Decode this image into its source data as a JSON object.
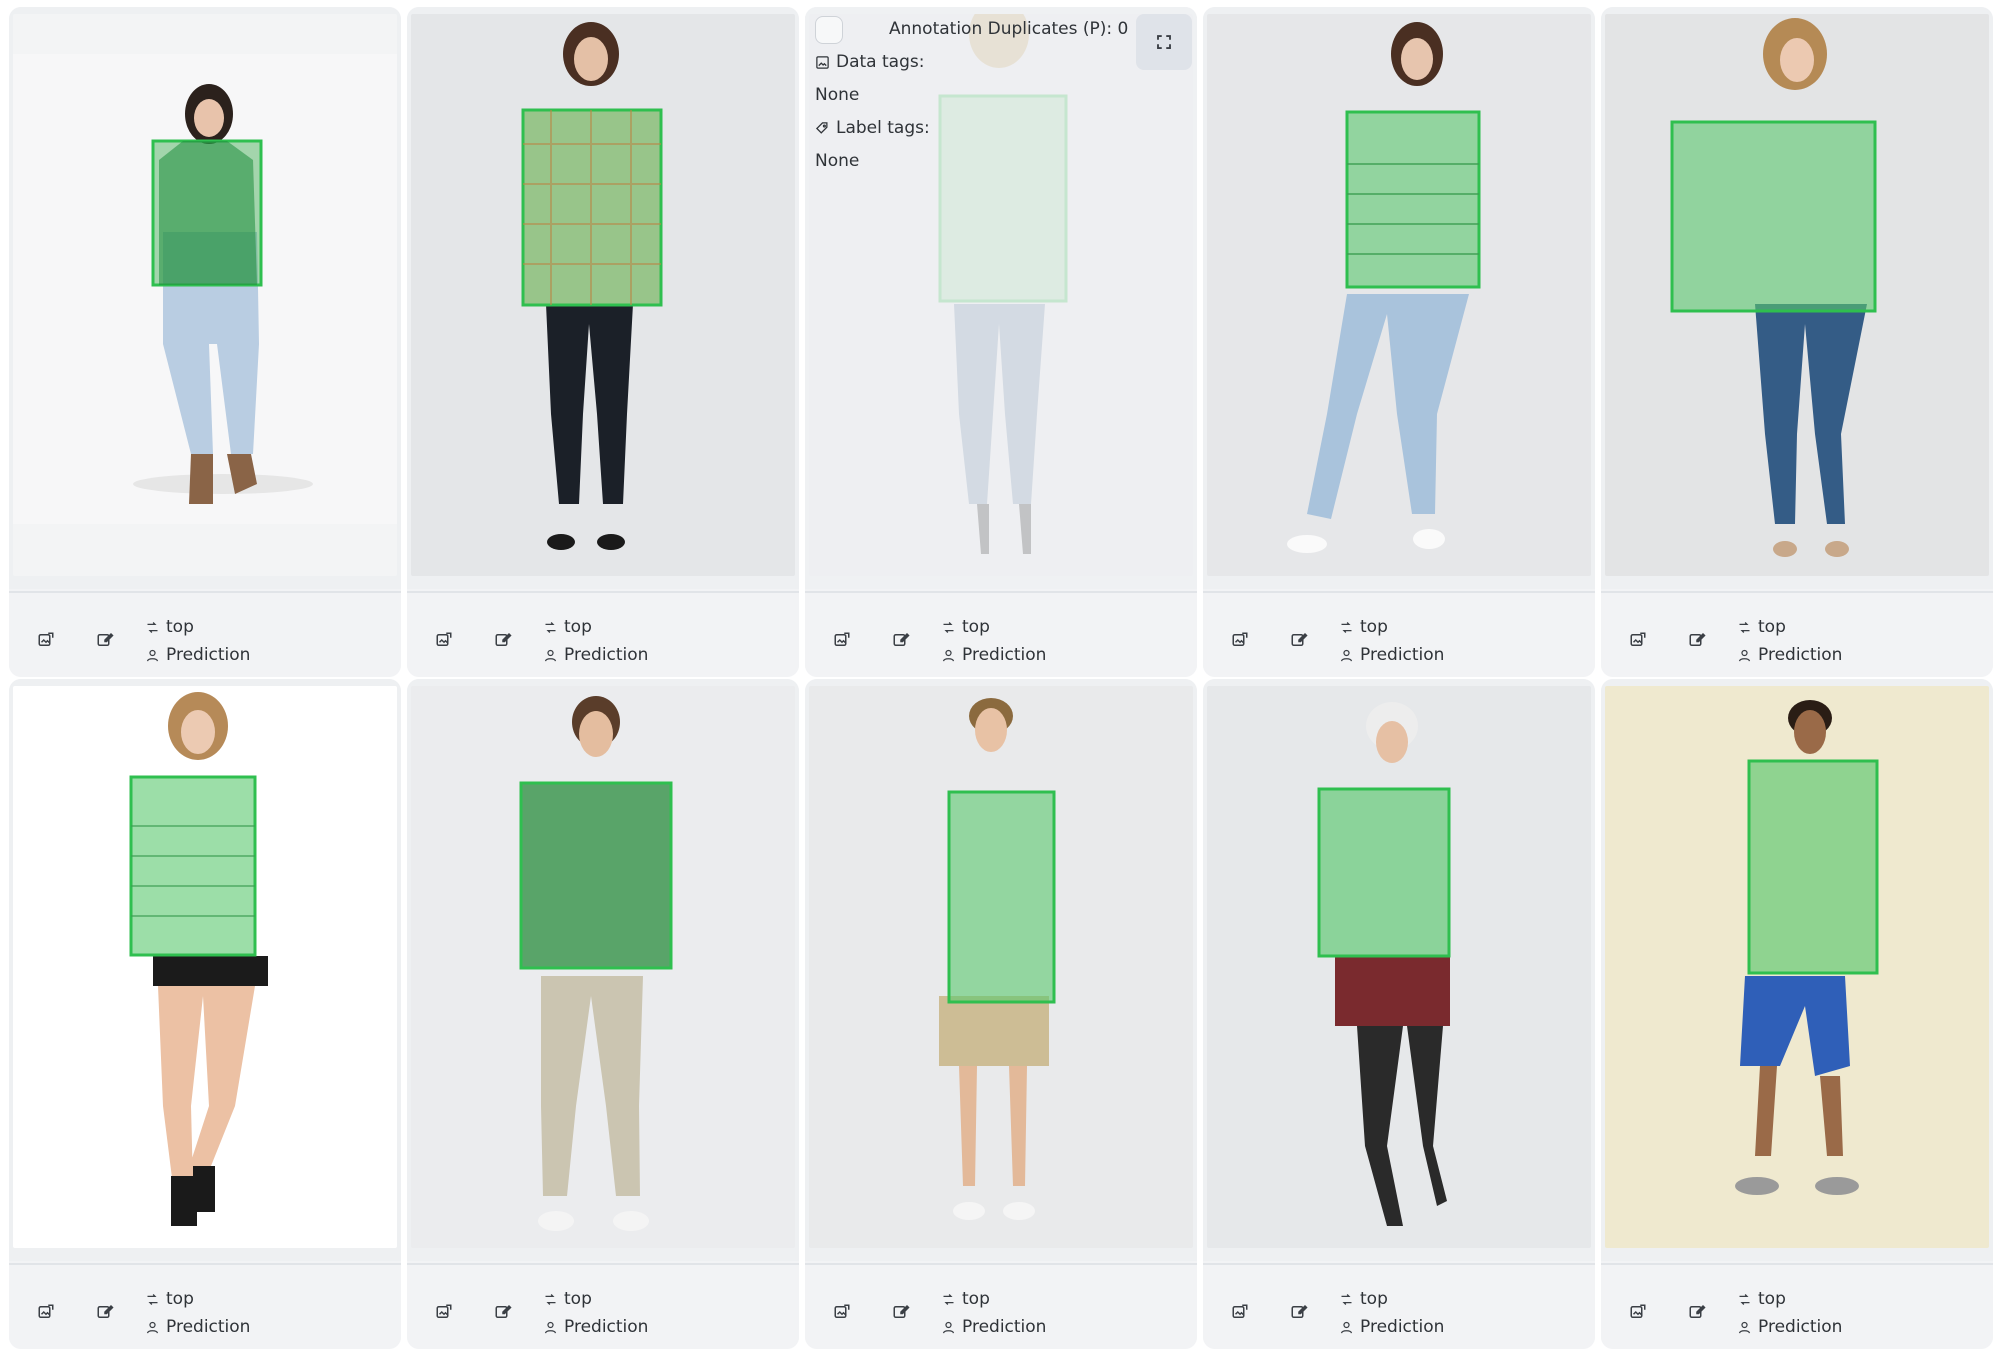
{
  "cards": [
    {
      "label": "top",
      "source": "Prediction"
    },
    {
      "label": "top",
      "source": "Prediction"
    },
    {
      "label": "top",
      "source": "Prediction"
    },
    {
      "label": "top",
      "source": "Prediction"
    },
    {
      "label": "top",
      "source": "Prediction"
    },
    {
      "label": "top",
      "source": "Prediction"
    },
    {
      "label": "top",
      "source": "Prediction"
    },
    {
      "label": "top",
      "source": "Prediction"
    },
    {
      "label": "top",
      "source": "Prediction"
    },
    {
      "label": "top",
      "source": "Prediction"
    }
  ],
  "hover_overlay": {
    "duplicates": "Annotation Duplicates (P): 0",
    "data_tags_label": "Data tags:",
    "data_tags_value": "None",
    "label_tags_label": "Label tags:",
    "label_tags_value": "None"
  },
  "colors": {
    "annotation": "#2fbf4f",
    "annotation_fill": "rgba(70,200,90,0.55)"
  }
}
